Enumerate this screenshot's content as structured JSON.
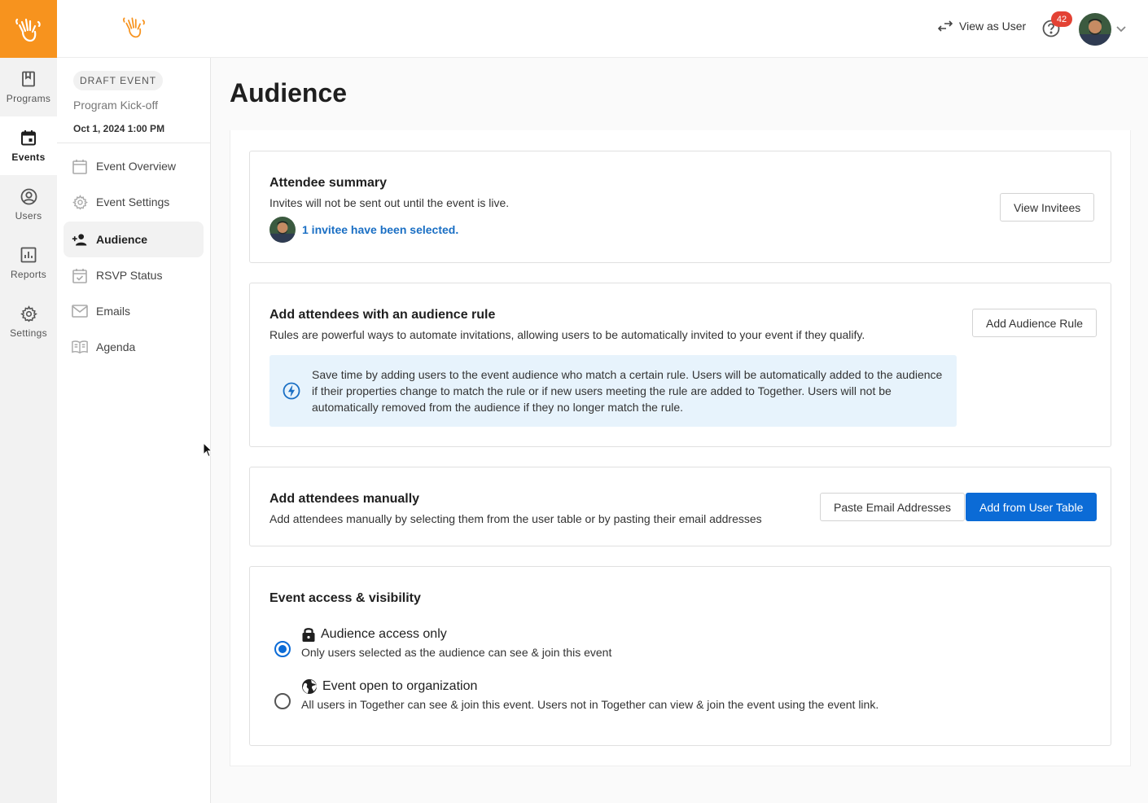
{
  "rail": {
    "items": [
      {
        "label": "Programs",
        "icon": "bookmark-icon"
      },
      {
        "label": "Events",
        "icon": "calendar-icon",
        "active": true
      },
      {
        "label": "Users",
        "icon": "user-circle-icon"
      },
      {
        "label": "Reports",
        "icon": "bar-chart-icon"
      },
      {
        "label": "Settings",
        "icon": "gear-icon"
      }
    ]
  },
  "topbar": {
    "view_as_user": "View as User",
    "help_badge_count": "42"
  },
  "sidenav": {
    "status_chip": "DRAFT EVENT",
    "event_name": "Program Kick-off",
    "event_date": "Oct 1, 2024 1:00 PM",
    "items": [
      {
        "label": "Event Overview",
        "icon": "calendar-icon"
      },
      {
        "label": "Event Settings",
        "icon": "gear-icon"
      },
      {
        "label": "Audience",
        "icon": "person-add-icon",
        "active": true
      },
      {
        "label": "RSVP Status",
        "icon": "calendar-check-icon"
      },
      {
        "label": "Emails",
        "icon": "mail-icon"
      },
      {
        "label": "Agenda",
        "icon": "book-icon"
      }
    ]
  },
  "page": {
    "title": "Audience"
  },
  "attendee_summary": {
    "title": "Attendee summary",
    "subtitle": "Invites will not be sent out until the event is live.",
    "invitee_text": "1 invitee have been selected.",
    "view_button": "View Invitees"
  },
  "audience_rule": {
    "title": "Add attendees with an audience rule",
    "subtitle": "Rules are powerful ways to automate invitations, allowing users to be automatically invited to your event if they qualify.",
    "add_button": "Add Audience Rule",
    "info": "Save time by adding users to the event audience who match a certain rule. Users will be automatically added to the audience if their properties change to match the rule or if new users meeting the rule are added to Together. Users will not be automatically removed from the audience if they no longer match the rule."
  },
  "manual": {
    "title": "Add attendees manually",
    "subtitle": "Add attendees manually by selecting them from the user table or by pasting their email addresses",
    "paste_button": "Paste Email Addresses",
    "user_table_button": "Add from User Table"
  },
  "access": {
    "title": "Event access & visibility",
    "options": [
      {
        "title": "Audience access only",
        "desc": "Only users selected as the audience can see & join this event",
        "icon": "lock-icon",
        "selected": true
      },
      {
        "title": "Event open to organization",
        "desc": "All users in Together can see & join this event. Users not in Together can view & join the event using the event link.",
        "icon": "globe-icon",
        "selected": false
      }
    ]
  },
  "colors": {
    "brand": "#f7931e",
    "primary": "#0b6bd6",
    "link": "#1a6fc4",
    "info_bg": "#e7f3fc",
    "badge": "#e34234"
  }
}
